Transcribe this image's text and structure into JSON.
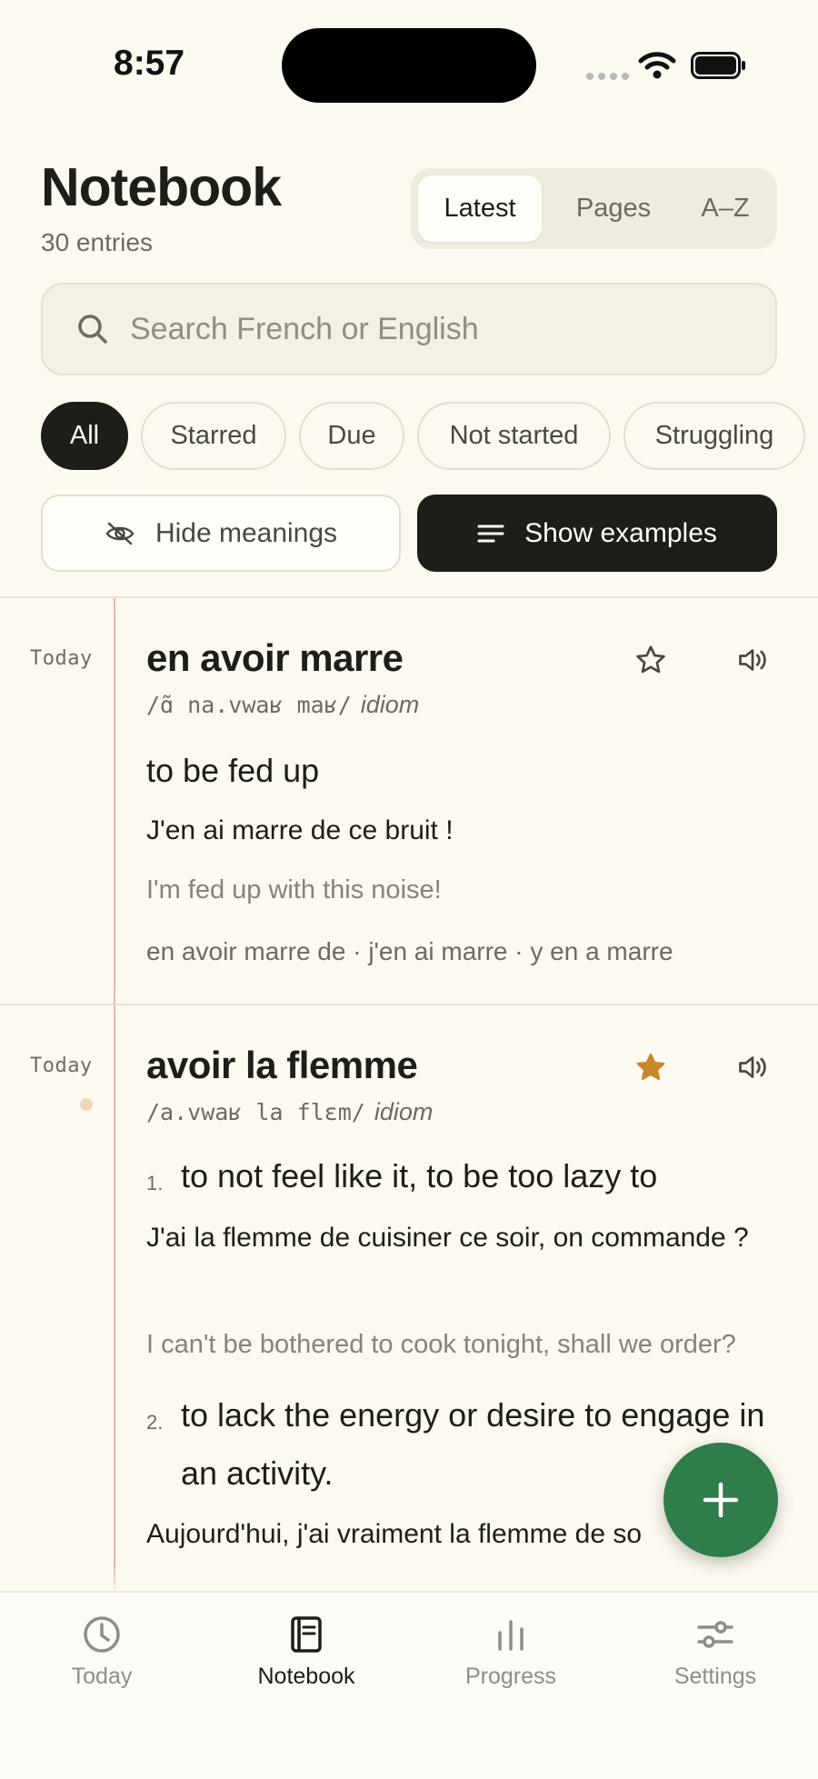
{
  "status": {
    "time": "8:57"
  },
  "header": {
    "title": "Notebook",
    "entries_count": "30 entries",
    "sort_tabs": [
      "Latest",
      "Pages",
      "A–Z"
    ],
    "active_sort": "Latest"
  },
  "search": {
    "placeholder": "Search French or English",
    "value": ""
  },
  "filters": {
    "chips": [
      "All",
      "Starred",
      "Due",
      "Not started",
      "Struggling"
    ],
    "active": "All"
  },
  "toggles": {
    "hide_meanings": "Hide meanings",
    "show_examples": "Show examples"
  },
  "entries": [
    {
      "date": "Today",
      "word": "en avoir marre",
      "ipa": "/ɑ̃ na.vwaʁ maʁ/",
      "pos": "idiom",
      "starred": false,
      "meaning": "to be fed up",
      "example": "J'en ai marre de ce bruit !",
      "translation": "I'm fed up with this noise!",
      "collocations": "en avoir marre de · j'en ai marre · y en a marre"
    },
    {
      "date": "Today",
      "word": "avoir la flemme",
      "ipa": "/a.vwaʁ la flɛm/",
      "pos": "idiom",
      "starred": true,
      "senses": [
        {
          "num": "1.",
          "meaning": "to not feel like it, to be too lazy to",
          "example": "J'ai la flemme de cuisiner ce soir, on commande ?",
          "translation": "I can't be bothered to cook tonight, shall we order?"
        },
        {
          "num": "2.",
          "meaning": "to lack the energy or desire to engage in an activity.",
          "example": "Aujourd'hui, j'ai vraiment la flemme de so"
        }
      ]
    }
  ],
  "fab": {
    "icon": "plus-icon"
  },
  "tabbar": {
    "items": [
      {
        "label": "Today",
        "icon": "clock-icon"
      },
      {
        "label": "Notebook",
        "icon": "notebook-icon"
      },
      {
        "label": "Progress",
        "icon": "bar-chart-icon"
      },
      {
        "label": "Settings",
        "icon": "sliders-icon"
      }
    ],
    "active": "Notebook"
  },
  "colors": {
    "background": "#fcfaf0",
    "ink": "#1f1d17",
    "accent_green": "#2f7d4a",
    "star_gold": "#c8882a",
    "margin_line": "#eab3ae"
  }
}
